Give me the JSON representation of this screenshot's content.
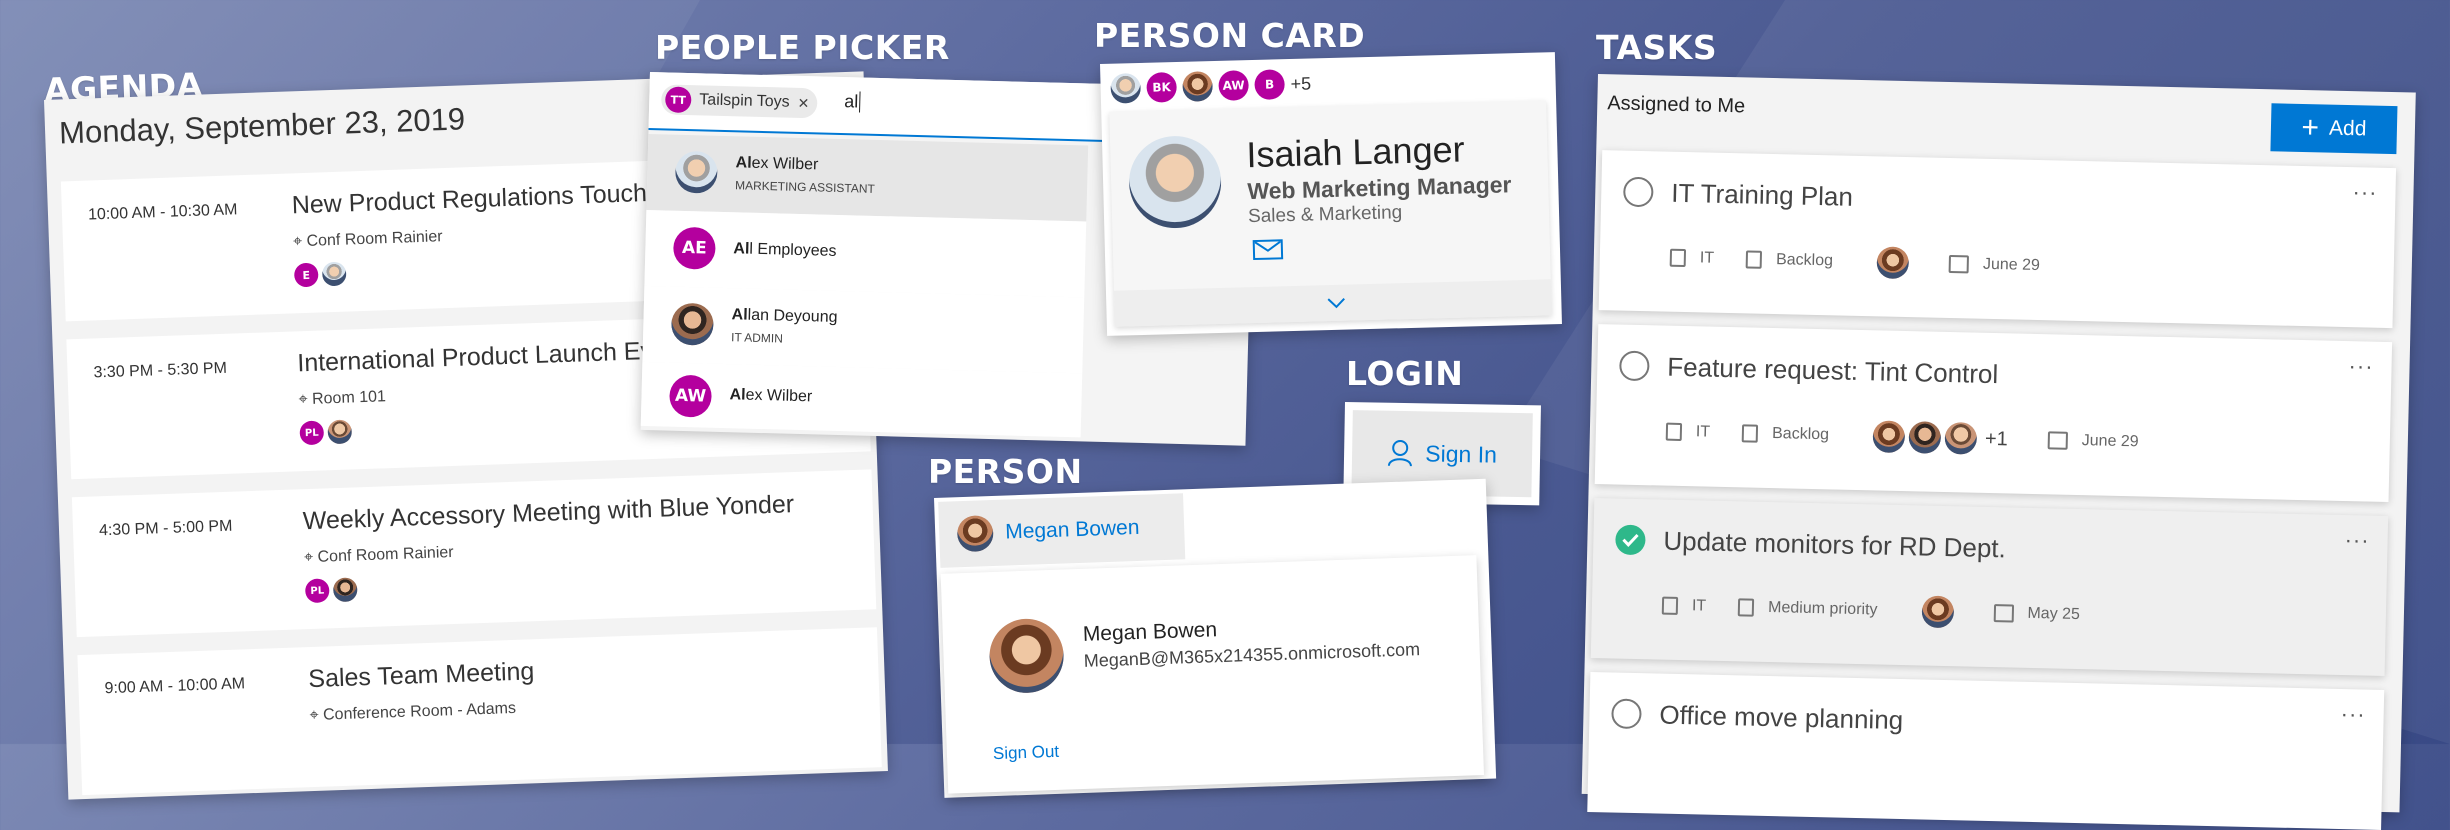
{
  "sections": {
    "agenda": "AGENDA",
    "people_picker": "PEOPLE PICKER",
    "person_card": "PERSON CARD",
    "login": "LOGIN",
    "person": "PERSON",
    "tasks": "TASKS"
  },
  "agenda": {
    "date": "Monday, September 23, 2019",
    "events": [
      {
        "time": "10:00 AM - 10:30 AM",
        "title": "New Product Regulations Touchpoint",
        "location": "Conf Room Rainier",
        "attendee_initial": "E"
      },
      {
        "time": "3:30 PM - 5:30 PM",
        "title": "International Product Launch Event",
        "location": "Room 101",
        "attendee_initial": "PL"
      },
      {
        "time": "4:30 PM - 5:00 PM",
        "title": "Weekly Accessory Meeting with Blue Yonder",
        "location": "Conf Room Rainier",
        "attendee_initial": "PL"
      },
      {
        "time": "9:00 AM - 10:00 AM",
        "title": "Sales Team Meeting",
        "location": "Conference Room - Adams",
        "attendee_initial": ""
      }
    ]
  },
  "picker": {
    "chip_initials": "TT",
    "chip_label": "Tailspin Toys",
    "chip_remove": "✕",
    "query": "al",
    "results": [
      {
        "bold": "Al",
        "rest": "ex Wilber",
        "sub": "MARKETING ASSISTANT",
        "initials": ""
      },
      {
        "bold": "Al",
        "rest": "l Employees",
        "sub": "",
        "initials": "AE"
      },
      {
        "bold": "Al",
        "rest": "lan Deyoung",
        "sub": "IT ADMIN",
        "initials": ""
      },
      {
        "bold": "Al",
        "rest": "ex Wilber",
        "sub": "",
        "initials": "AW"
      }
    ]
  },
  "person_card": {
    "avatars": [
      "",
      "BK",
      "",
      "AW",
      "B"
    ],
    "more": "+5",
    "name": "Isaiah Langer",
    "title": "Web Marketing Manager",
    "department": "Sales & Marketing",
    "mail_icon": "mail-icon",
    "expand_icon": "chevron-down-icon"
  },
  "login": {
    "label": "Sign In"
  },
  "person": {
    "name": "Megan Bowen",
    "display_name": "Megan Bowen",
    "email": "MeganB@M365x214355.onmicrosoft.com",
    "sign_out": "Sign Out"
  },
  "tasks": {
    "header": "Assigned to Me",
    "add_label": "Add",
    "items": [
      {
        "title": "IT Training Plan",
        "group": "IT",
        "bucket": "Backlog",
        "due": "June 29",
        "done": false,
        "extra": ""
      },
      {
        "title": "Feature request: Tint Control",
        "group": "IT",
        "bucket": "Backlog",
        "due": "June 29",
        "done": false,
        "extra": "+1"
      },
      {
        "title": "Update monitors for RD Dept.",
        "group": "IT",
        "bucket": "Medium priority",
        "due": "May 25",
        "done": true,
        "extra": ""
      },
      {
        "title": "Office move planning",
        "group": "",
        "bucket": "",
        "due": "",
        "done": false,
        "extra": ""
      }
    ],
    "more_menu": "···"
  },
  "colors": {
    "accent": "#0078d4",
    "magenta": "#b4009e",
    "done_green": "#2eb88a"
  }
}
